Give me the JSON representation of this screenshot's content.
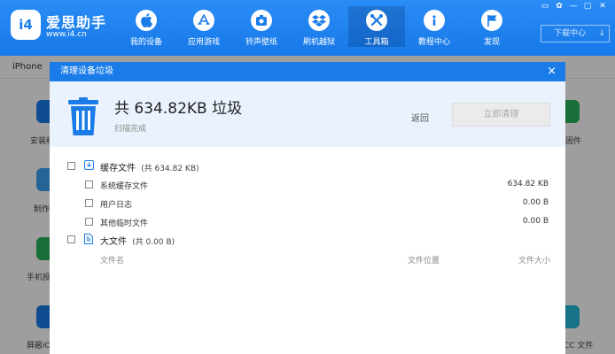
{
  "app": {
    "logo_text": "i4",
    "brand": "爱思助手",
    "site": "www.i4.cn"
  },
  "nav": [
    {
      "label": "我的设备",
      "icon": "apple-icon"
    },
    {
      "label": "应用游戏",
      "icon": "app-store-icon"
    },
    {
      "label": "铃声壁纸",
      "icon": "ringtone-icon"
    },
    {
      "label": "刷机越狱",
      "icon": "dropbox-icon"
    },
    {
      "label": "工具箱",
      "icon": "tools-icon",
      "active": true
    },
    {
      "label": "教程中心",
      "icon": "info-icon"
    },
    {
      "label": "发现",
      "icon": "flag-icon"
    }
  ],
  "window_controls": [
    "▭",
    "✿",
    "—",
    "▢",
    "✕"
  ],
  "download_center": {
    "label": "下载中心",
    "arrow": "↓"
  },
  "device_tab": "iPhone",
  "bg_labels": {
    "l1": "安装移",
    "l2": "制作",
    "l3": "手机投",
    "l4": "屏蔽iO",
    "r1": "固件",
    "r4": "CC 文件"
  },
  "dialog": {
    "title": "清理设备垃圾",
    "close": "×",
    "total": "共 634.82KB 垃圾",
    "status": "扫描完成",
    "back": "返回",
    "clean": "立即清理",
    "cache": {
      "label": "缓存文件",
      "count": "(共 634.82 KB)"
    },
    "items": [
      {
        "name": "系统缓存文件",
        "size": "634.82 KB"
      },
      {
        "name": "用户日志",
        "size": "0.00 B"
      },
      {
        "name": "其他临时文件",
        "size": "0.00 B"
      }
    ],
    "large": {
      "label": "大文件",
      "count": "(共 0.00 B)"
    },
    "columns": {
      "name": "文件名",
      "location": "文件位置",
      "size": "文件大小"
    }
  },
  "colors": {
    "primary": "#1a7ce9",
    "dialog_header": "#1a7ce9",
    "light_bg": "#eaf3fd"
  }
}
